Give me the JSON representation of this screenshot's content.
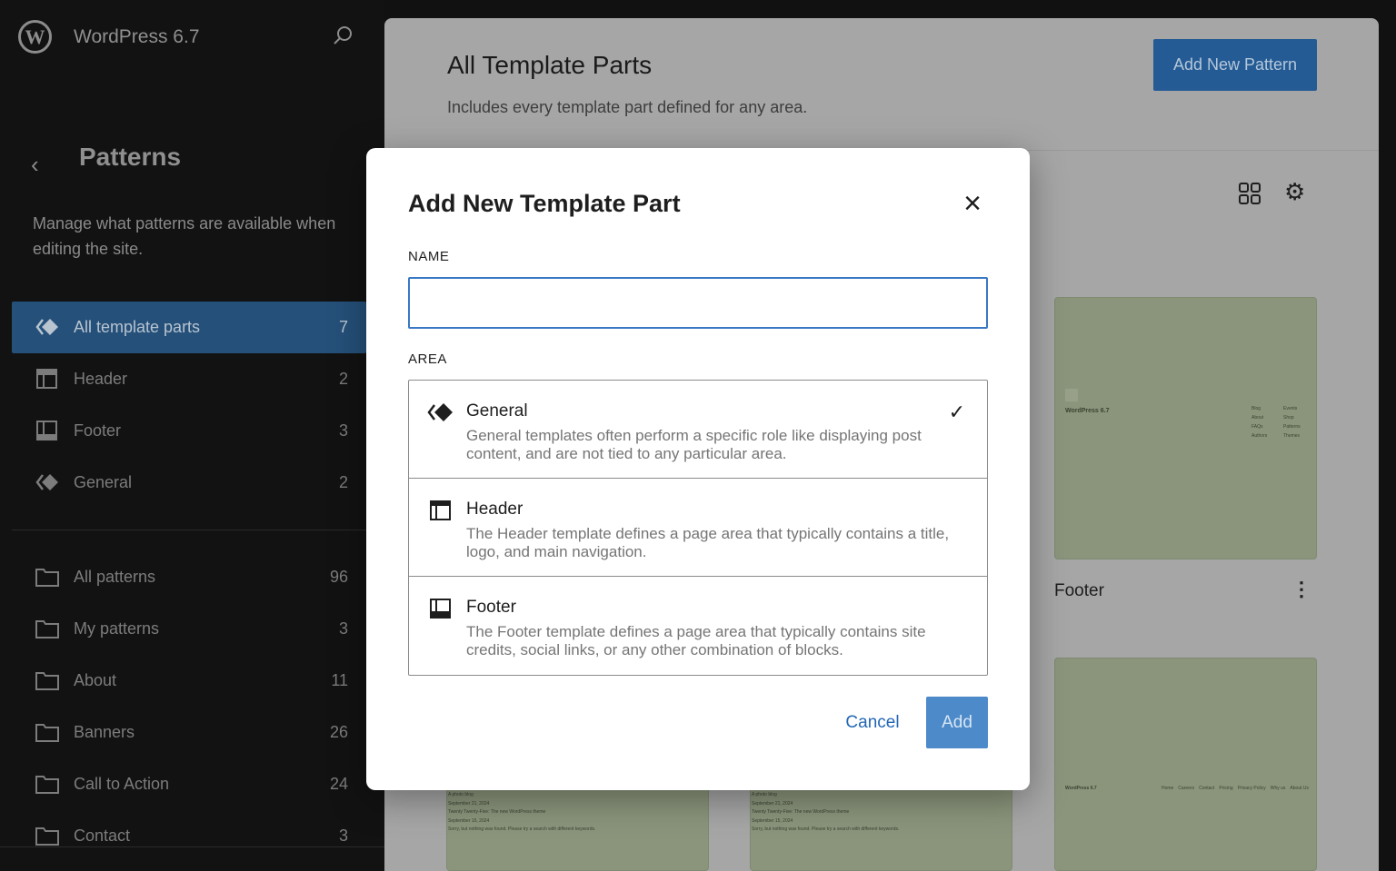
{
  "sidebar": {
    "site_title": "WordPress 6.7",
    "title": "Patterns",
    "description": "Manage what patterns are available when editing the site.",
    "template_parts": [
      {
        "label": "All template parts",
        "count": "7",
        "icon": "symbol-icon"
      },
      {
        "label": "Header",
        "count": "2",
        "icon": "header-icon"
      },
      {
        "label": "Footer",
        "count": "3",
        "icon": "footer-icon"
      },
      {
        "label": "General",
        "count": "2",
        "icon": "symbol-icon"
      }
    ],
    "categories": [
      {
        "label": "All patterns",
        "count": "96"
      },
      {
        "label": "My patterns",
        "count": "3"
      },
      {
        "label": "About",
        "count": "11"
      },
      {
        "label": "Banners",
        "count": "26"
      },
      {
        "label": "Call to Action",
        "count": "24"
      },
      {
        "label": "Contact",
        "count": "3"
      }
    ]
  },
  "main": {
    "title": "All Template Parts",
    "subtitle": "Includes every template part defined for any area.",
    "add_button": "Add New Pattern",
    "cards": [
      {
        "label": "Footer",
        "thumb_title": "WordPress 6.7",
        "thumb_links": [
          "Blog",
          "About",
          "FAQs",
          "Authors",
          "Events",
          "Shop",
          "Patterns",
          "Themes"
        ]
      },
      {
        "thumb_title": "WordPress 6.7",
        "thumb_links": [
          "Home",
          "Careers",
          "Contact",
          "Pricing",
          "Privacy Policy",
          "Why us",
          "About Us"
        ]
      },
      {
        "thumb_lines": [
          "A photo blog",
          "September 21, 2024",
          "Twenty Twenty-Five: The new WordPress theme",
          "September 15, 2024",
          "Sorry, but nothing was found. Please try a search with different keywords."
        ]
      },
      {
        "thumb_lines": [
          "A photo blog",
          "September 21, 2024",
          "Twenty Twenty-Five: The new WordPress theme",
          "September 15, 2024",
          "Sorry, but nothing was found. Please try a search with different keywords."
        ]
      }
    ]
  },
  "modal": {
    "title": "Add New Template Part",
    "name_label": "NAME",
    "name_value": "",
    "area_label": "AREA",
    "areas": [
      {
        "name": "General",
        "description": "General templates often perform a specific role like displaying post content, and are not tied to any particular area.",
        "selected": true
      },
      {
        "name": "Header",
        "description": "The Header template defines a page area that typically contains a title, logo, and main navigation."
      },
      {
        "name": "Footer",
        "description": "The Footer template defines a page area that typically contains site credits, social links, or any other combination of blocks."
      }
    ],
    "cancel": "Cancel",
    "add": "Add",
    "check": "✓",
    "close": "×"
  },
  "colors": {
    "accent": "#3a78c4",
    "selected_nav": "#255079",
    "card": "#8b957c"
  }
}
